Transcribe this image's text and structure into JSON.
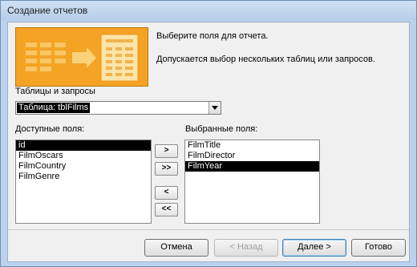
{
  "window": {
    "title": "Создание отчетов"
  },
  "intro": {
    "line1": "Выберите поля для отчета.",
    "line2": "Допускается выбор нескольких таблиц или запросов."
  },
  "source": {
    "label": "Таблицы и запросы",
    "selected": "Таблица: tblFilms"
  },
  "available": {
    "label": "Доступные поля:",
    "items": [
      "id",
      "FilmOscars",
      "FilmCountry",
      "FilmGenre"
    ],
    "selected_index": 0
  },
  "chosen": {
    "label": "Выбранные поля:",
    "items": [
      "FilmTitle",
      "FilmDirector",
      "FilmYear"
    ],
    "selected_index": 2
  },
  "move_buttons": {
    "add_one": ">",
    "add_all": ">>",
    "remove_one": "<",
    "remove_all": "<<"
  },
  "buttons": {
    "cancel": "Отмена",
    "back": "< Назад",
    "next": "Далее >",
    "finish": "Готово"
  },
  "colors": {
    "hero_orange": "#f4a324",
    "selection": "#000000",
    "window_frame": "#bcd2ec"
  }
}
